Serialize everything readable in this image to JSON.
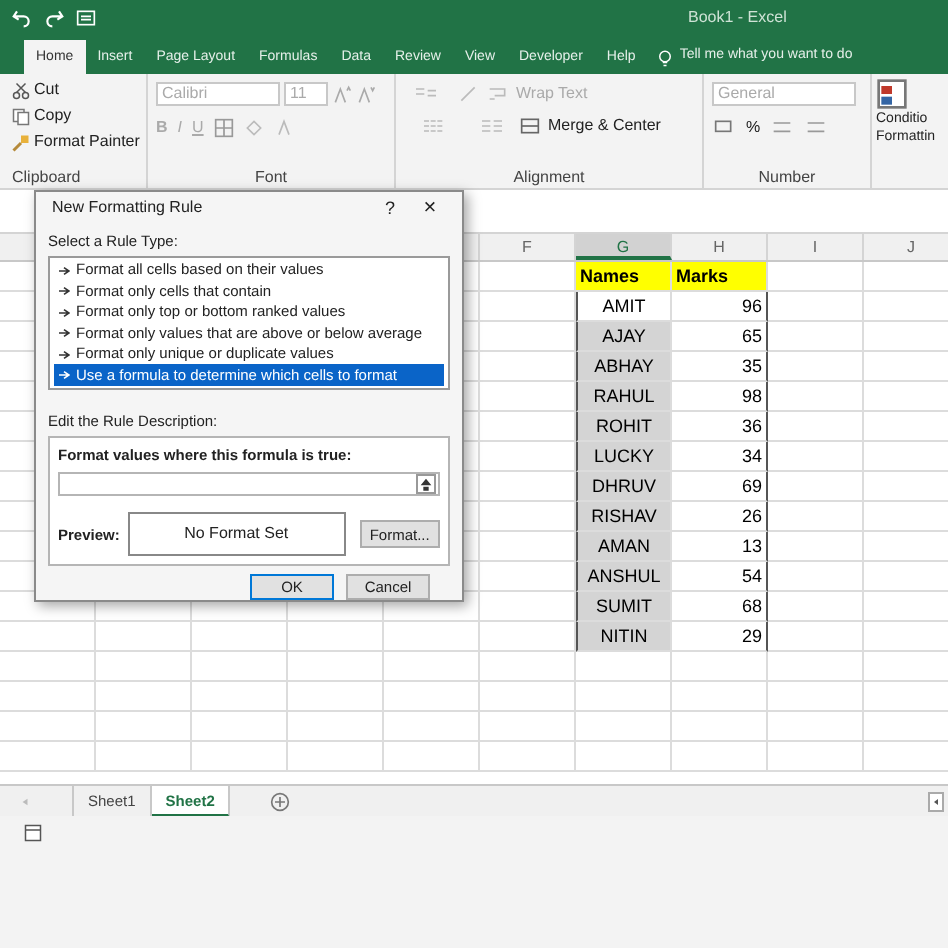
{
  "title_bar": {
    "title": "Book1 - Excel"
  },
  "tabs": [
    {
      "label": "Home",
      "selected": true
    },
    {
      "label": "Insert",
      "selected": false
    },
    {
      "label": "Page Layout",
      "selected": false
    },
    {
      "label": "Formulas",
      "selected": false
    },
    {
      "label": "Data",
      "selected": false
    },
    {
      "label": "Review",
      "selected": false
    },
    {
      "label": "View",
      "selected": false
    },
    {
      "label": "Developer",
      "selected": false
    },
    {
      "label": "Help",
      "selected": false
    }
  ],
  "tell_me": "Tell me what you want to do",
  "ribbon": {
    "clipboard": {
      "cut": "Cut",
      "copy": "Copy",
      "format_painter": "Format Painter",
      "label": "Clipboard"
    },
    "font": {
      "font_name": "Calibri",
      "font_size": "11",
      "bold": "B",
      "italic": "I",
      "underline": "U",
      "label": "Font"
    },
    "alignment": {
      "wrap_text": "Wrap Text",
      "merge": "Merge & Center",
      "label": "Alignment"
    },
    "number": {
      "format": "General",
      "percent": "%",
      "label": "Number"
    },
    "conditional": [
      "Conditio",
      "Formattin"
    ]
  },
  "sheet": {
    "columns": [
      {
        "label": "F",
        "selected": false
      },
      {
        "label": "G",
        "selected": true
      },
      {
        "label": "H",
        "selected": false
      },
      {
        "label": "I",
        "selected": false
      },
      {
        "label": "J",
        "selected": false
      }
    ],
    "rows": [
      {
        "kind": "header",
        "name": "Names",
        "marks": "Marks"
      },
      {
        "kind": "data",
        "name": "AMIT",
        "marks": "96",
        "active": true
      },
      {
        "kind": "data",
        "name": "AJAY",
        "marks": "65",
        "active": false
      },
      {
        "kind": "data",
        "name": "ABHAY",
        "marks": "35",
        "active": false
      },
      {
        "kind": "data",
        "name": "RAHUL",
        "marks": "98",
        "active": false
      },
      {
        "kind": "data",
        "name": "ROHIT",
        "marks": "36",
        "active": false
      },
      {
        "kind": "data",
        "name": "LUCKY",
        "marks": "34",
        "active": false
      },
      {
        "kind": "data",
        "name": "DHRUV",
        "marks": "69",
        "active": false
      },
      {
        "kind": "data",
        "name": "RISHAV",
        "marks": "26",
        "active": false
      },
      {
        "kind": "data",
        "name": "AMAN",
        "marks": "13",
        "active": false
      },
      {
        "kind": "data",
        "name": "ANSHUL",
        "marks": "54",
        "active": false
      },
      {
        "kind": "data",
        "name": "SUMIT",
        "marks": "68",
        "active": false
      },
      {
        "kind": "data",
        "name": "NITIN",
        "marks": "29",
        "active": false
      }
    ]
  },
  "dialog": {
    "title": "New Formatting Rule",
    "help": "?",
    "close": "×",
    "select_label": "Select a Rule Type:",
    "rule_types": [
      {
        "label": "Format all cells based on their values",
        "selected": false
      },
      {
        "label": "Format only cells that contain",
        "selected": false
      },
      {
        "label": "Format only top or bottom ranked values",
        "selected": false
      },
      {
        "label": "Format only values that are above or below average",
        "selected": false
      },
      {
        "label": "Format only unique or duplicate values",
        "selected": false
      },
      {
        "label": "Use a formula to determine which cells to format",
        "selected": true
      }
    ],
    "edit_label": "Edit the Rule Description:",
    "formula_label": "Format values where this formula is true:",
    "preview_label": "Preview:",
    "preview_text": "No Format Set",
    "format_button": "Format...",
    "ok": "OK",
    "cancel": "Cancel"
  },
  "sheet_tabs": [
    {
      "label": "Sheet1",
      "selected": false
    },
    {
      "label": "Sheet2",
      "selected": true
    }
  ]
}
